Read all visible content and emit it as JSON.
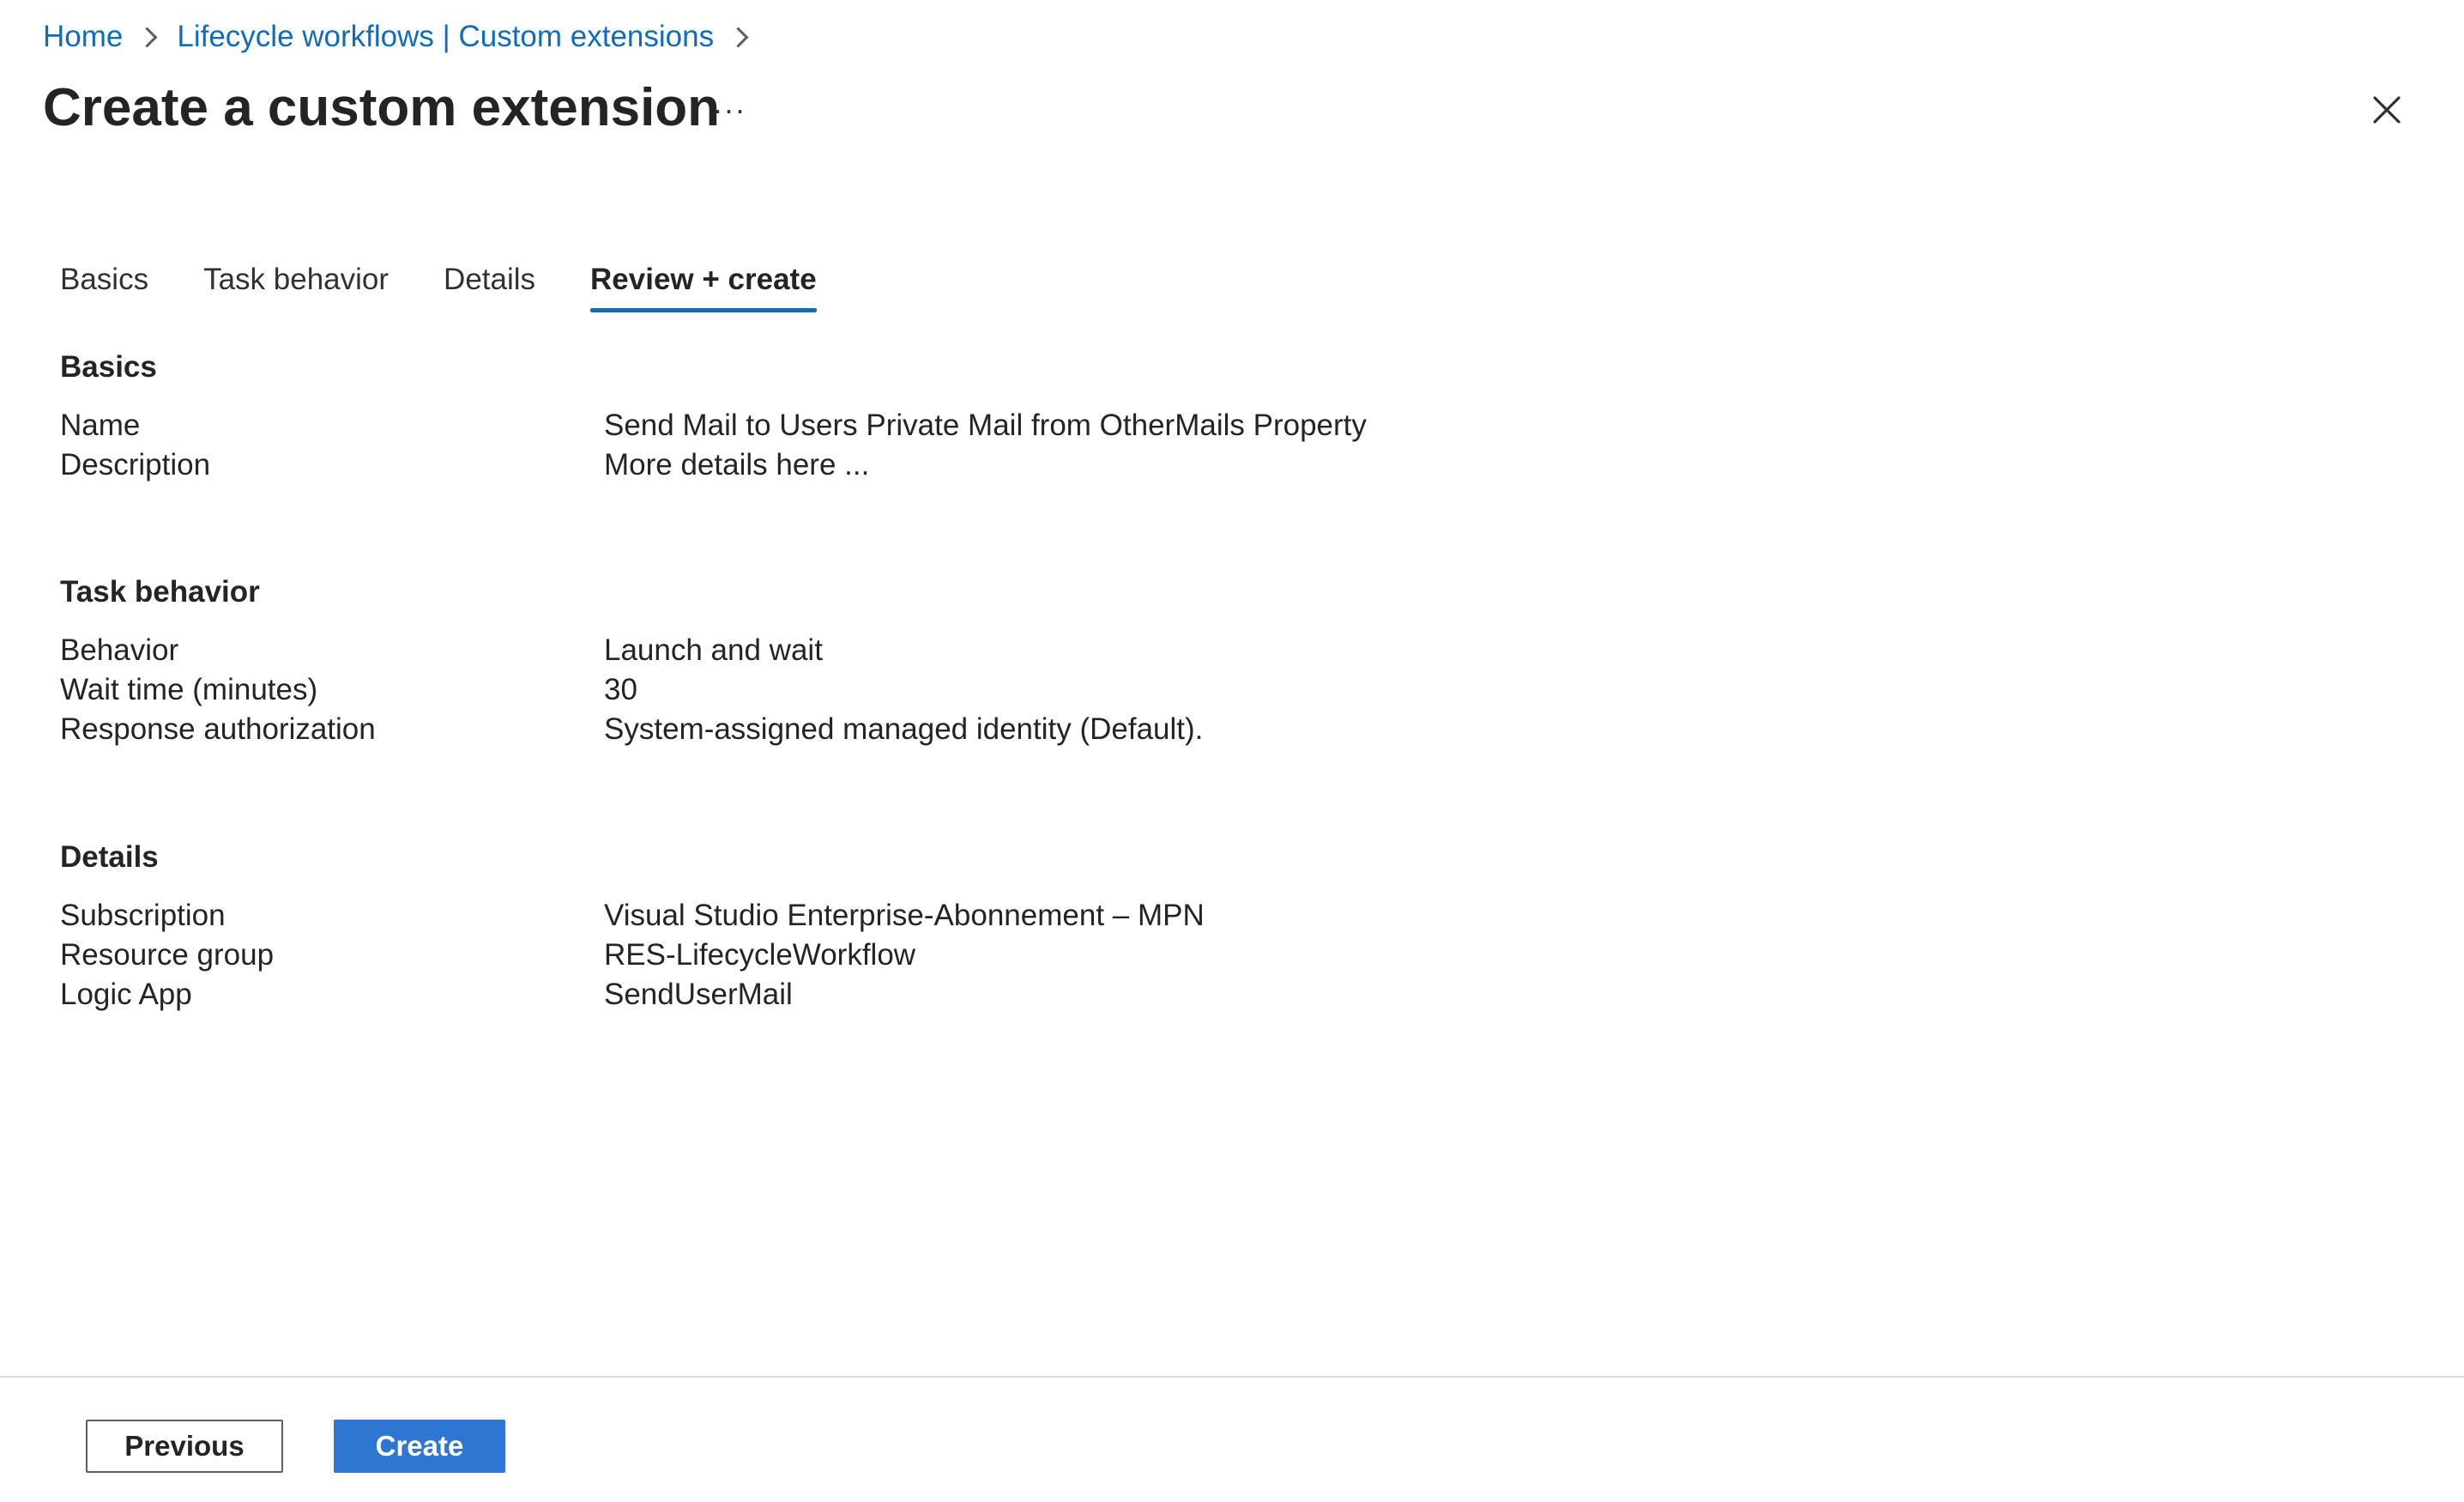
{
  "breadcrumb": {
    "items": [
      "Home",
      "Lifecycle workflows | Custom extensions"
    ]
  },
  "header": {
    "title": "Create a custom extension",
    "more_label": "···"
  },
  "tabs": [
    {
      "label": "Basics",
      "active": false
    },
    {
      "label": "Task behavior",
      "active": false
    },
    {
      "label": "Details",
      "active": false
    },
    {
      "label": "Review + create",
      "active": true
    }
  ],
  "sections": {
    "basics": {
      "heading": "Basics",
      "rows": [
        {
          "label": "Name",
          "value": "Send Mail to Users Private Mail from OtherMails Property"
        },
        {
          "label": "Description",
          "value": "More details here ..."
        }
      ]
    },
    "task_behavior": {
      "heading": "Task behavior",
      "rows": [
        {
          "label": "Behavior",
          "value": "Launch and wait"
        },
        {
          "label": "Wait time (minutes)",
          "value": "30"
        },
        {
          "label": "Response authorization",
          "value": "System-assigned managed identity (Default)."
        }
      ]
    },
    "details": {
      "heading": "Details",
      "rows": [
        {
          "label": "Subscription",
          "value": "Visual Studio Enterprise-Abonnement – MPN"
        },
        {
          "label": "Resource group",
          "value": "RES-LifecycleWorkflow"
        },
        {
          "label": "Logic App",
          "value": "SendUserMail"
        }
      ]
    }
  },
  "footer": {
    "previous_label": "Previous",
    "create_label": "Create"
  },
  "colors": {
    "link": "#0f6cbd",
    "primary_button": "#2f76d2",
    "tab_indicator": "#0f6cbd",
    "text": "#242424"
  },
  "icons": {
    "close": "close-icon",
    "breadcrumb_separator": "chevron-right-icon"
  }
}
